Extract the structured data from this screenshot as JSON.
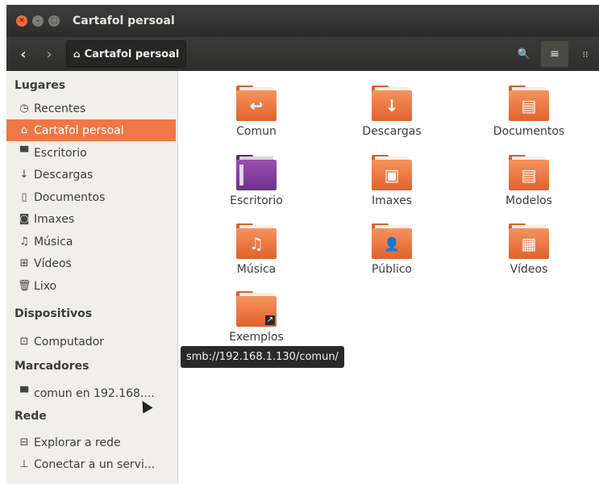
{
  "window": {
    "title": "Cartafol persoal",
    "close_glyph": "✕",
    "min_glyph": "–",
    "max_glyph": "□"
  },
  "toolbar": {
    "back_icon": "chevron-left",
    "back_glyph": "‹",
    "forward_icon": "chevron-right",
    "forward_glyph": "›",
    "breadcrumb_label": "Cartafol persoal",
    "breadcrumb_icon": "home",
    "home_glyph": "⌂",
    "search_glyph": "🔍",
    "list_glyph": "≡",
    "grid_glyph": "⁝⁝"
  },
  "sidebar": {
    "sections": {
      "places": "Lugares",
      "devices": "Dispositivos",
      "bookmarks": "Marcadores",
      "network": "Rede"
    },
    "places": [
      {
        "label": "Recentes",
        "icon": "clock",
        "glyph": "◷",
        "active": false
      },
      {
        "label": "Cartafol persoal",
        "icon": "home",
        "glyph": "⌂",
        "active": true
      },
      {
        "label": "Escritorio",
        "icon": "folder",
        "glyph": "▀",
        "active": false
      },
      {
        "label": "Descargas",
        "icon": "download",
        "glyph": "↓",
        "active": false
      },
      {
        "label": "Documentos",
        "icon": "document",
        "glyph": "▯",
        "active": false
      },
      {
        "label": "Imaxes",
        "icon": "camera",
        "glyph": "◙",
        "active": false
      },
      {
        "label": "Música",
        "icon": "music",
        "glyph": "♫",
        "active": false
      },
      {
        "label": "Vídeos",
        "icon": "film",
        "glyph": "⊞",
        "active": false
      },
      {
        "label": "Lixo",
        "icon": "trash",
        "glyph": "🗑",
        "active": false
      }
    ],
    "devices": [
      {
        "label": "Computador",
        "icon": "computer",
        "glyph": "⊡"
      }
    ],
    "bookmarks": [
      {
        "label": "comun en 192.168....",
        "icon": "network-folder",
        "glyph": "▀"
      }
    ],
    "network": [
      {
        "label": "Explorar a rede",
        "icon": "network",
        "glyph": "⊟"
      },
      {
        "label": "Conectar a un servi...",
        "icon": "server",
        "glyph": "⊥"
      }
    ]
  },
  "main": {
    "items": [
      {
        "label": "Comun",
        "icon": "folder-link",
        "emblem": "↩"
      },
      {
        "label": "Descargas",
        "icon": "folder-download",
        "emblem": "↓"
      },
      {
        "label": "Documentos",
        "icon": "folder-documents",
        "emblem": "▤"
      },
      {
        "label": "Escritorio",
        "icon": "folder-desktop",
        "emblem": ""
      },
      {
        "label": "Imaxes",
        "icon": "folder-pictures",
        "emblem": "▣"
      },
      {
        "label": "Modelos",
        "icon": "folder-templates",
        "emblem": "▤"
      },
      {
        "label": "Música",
        "icon": "folder-music",
        "emblem": "♫"
      },
      {
        "label": "Público",
        "icon": "folder-public",
        "emblem": "👤"
      },
      {
        "label": "Vídeos",
        "icon": "folder-videos",
        "emblem": "▦"
      },
      {
        "label": "Exemplos",
        "icon": "folder-examples",
        "emblem": ""
      }
    ],
    "tooltip": "smb://192.168.1.130/comun/"
  }
}
